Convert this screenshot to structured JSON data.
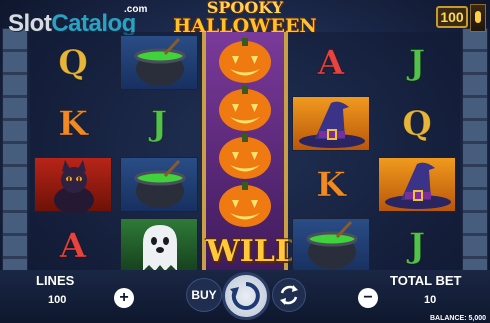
{
  "brand": {
    "name_main": "Slot",
    "name_accent": "Catalog",
    "suffix": ".com"
  },
  "game": {
    "title_line1": "SPOOKY",
    "title_line2": "HALLOWEEN"
  },
  "header": {
    "coin_value": "100"
  },
  "reels": [
    {
      "symbols": [
        "Q",
        "K",
        "black-cat",
        "A"
      ]
    },
    {
      "symbols": [
        "cauldron",
        "J",
        "cauldron",
        "ghost"
      ]
    },
    {
      "symbols": [
        "pumpkin-wild",
        "pumpkin-wild",
        "pumpkin-wild",
        "pumpkin-wild"
      ],
      "wild_label": "WILD"
    },
    {
      "symbols": [
        "A",
        "witch-hat",
        "K",
        "cauldron"
      ]
    },
    {
      "symbols": [
        "J",
        "Q",
        "witch-hat",
        "J"
      ]
    }
  ],
  "controls": {
    "lines_label": "LINES",
    "lines_value": "100",
    "buy_label": "BUY",
    "total_bet_label": "TOTAL BET",
    "total_bet_value": "10",
    "plus_icon": "+",
    "minus_icon": "−"
  },
  "status": {
    "balance": "BALANCE: 5,000"
  },
  "colors": {
    "wild_reel": "#5a2a7a",
    "gold": "#ffc93a",
    "accent": "#2aa2c4"
  }
}
